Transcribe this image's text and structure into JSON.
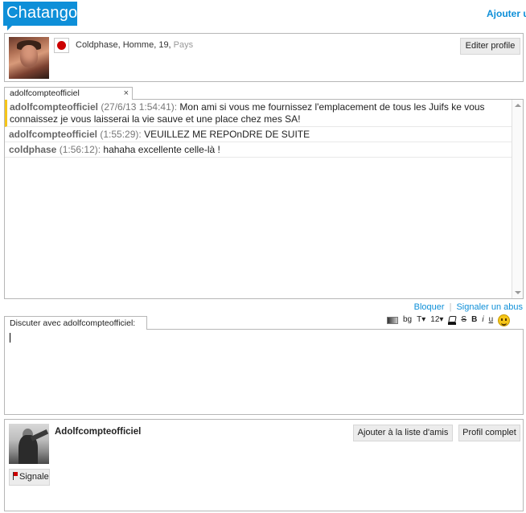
{
  "header": {
    "logo": "Chatango",
    "add_link": "Ajouter u"
  },
  "profile": {
    "username": "Coldphase",
    "details": ", Homme, 19, ",
    "country_label": "Pays",
    "edit_button": "Editer profile"
  },
  "tab": {
    "label": "adolfcompteofficiel",
    "close": "×"
  },
  "messages": [
    {
      "user": "adolfcompteofficiel",
      "time": "(27/6/13 1:54:41):",
      "text": " Mon ami si vous me fournissez l'emplacement de tous les Juifs ke vous connaissez je vous laisserai la vie sauve et une place chez mes SA!"
    },
    {
      "user": "adolfcompteofficiel",
      "time": "(1:55:29):",
      "text": " VEUILLEZ ME REPOnDRE DE SUITE"
    },
    {
      "user": "coldphase",
      "time": "(1:56:12):",
      "text": " hahaha excellente celle-là !"
    }
  ],
  "actions": {
    "block": "Bloquer",
    "report_abuse": "Signaler un abus"
  },
  "compose": {
    "tab_label": "Discuter avec adolfcompteofficiel:",
    "value": ""
  },
  "toolbar": {
    "bg": "bg",
    "font": "T▾",
    "size": "12▾",
    "strike": "S",
    "bold": "B",
    "italic": "i",
    "underline": "u",
    "icons": [
      "gradient-icon",
      "fill-color-icon",
      "smiley-icon"
    ]
  },
  "other_user": {
    "name": "Adolfcompteofficiel",
    "add_friend": "Ajouter à la liste d'amis",
    "full_profile": "Profil complet",
    "report": "Signale"
  },
  "colors": {
    "brand": "#0e8fd8",
    "highlight": "#f5c518",
    "border": "#b7b7b7"
  }
}
